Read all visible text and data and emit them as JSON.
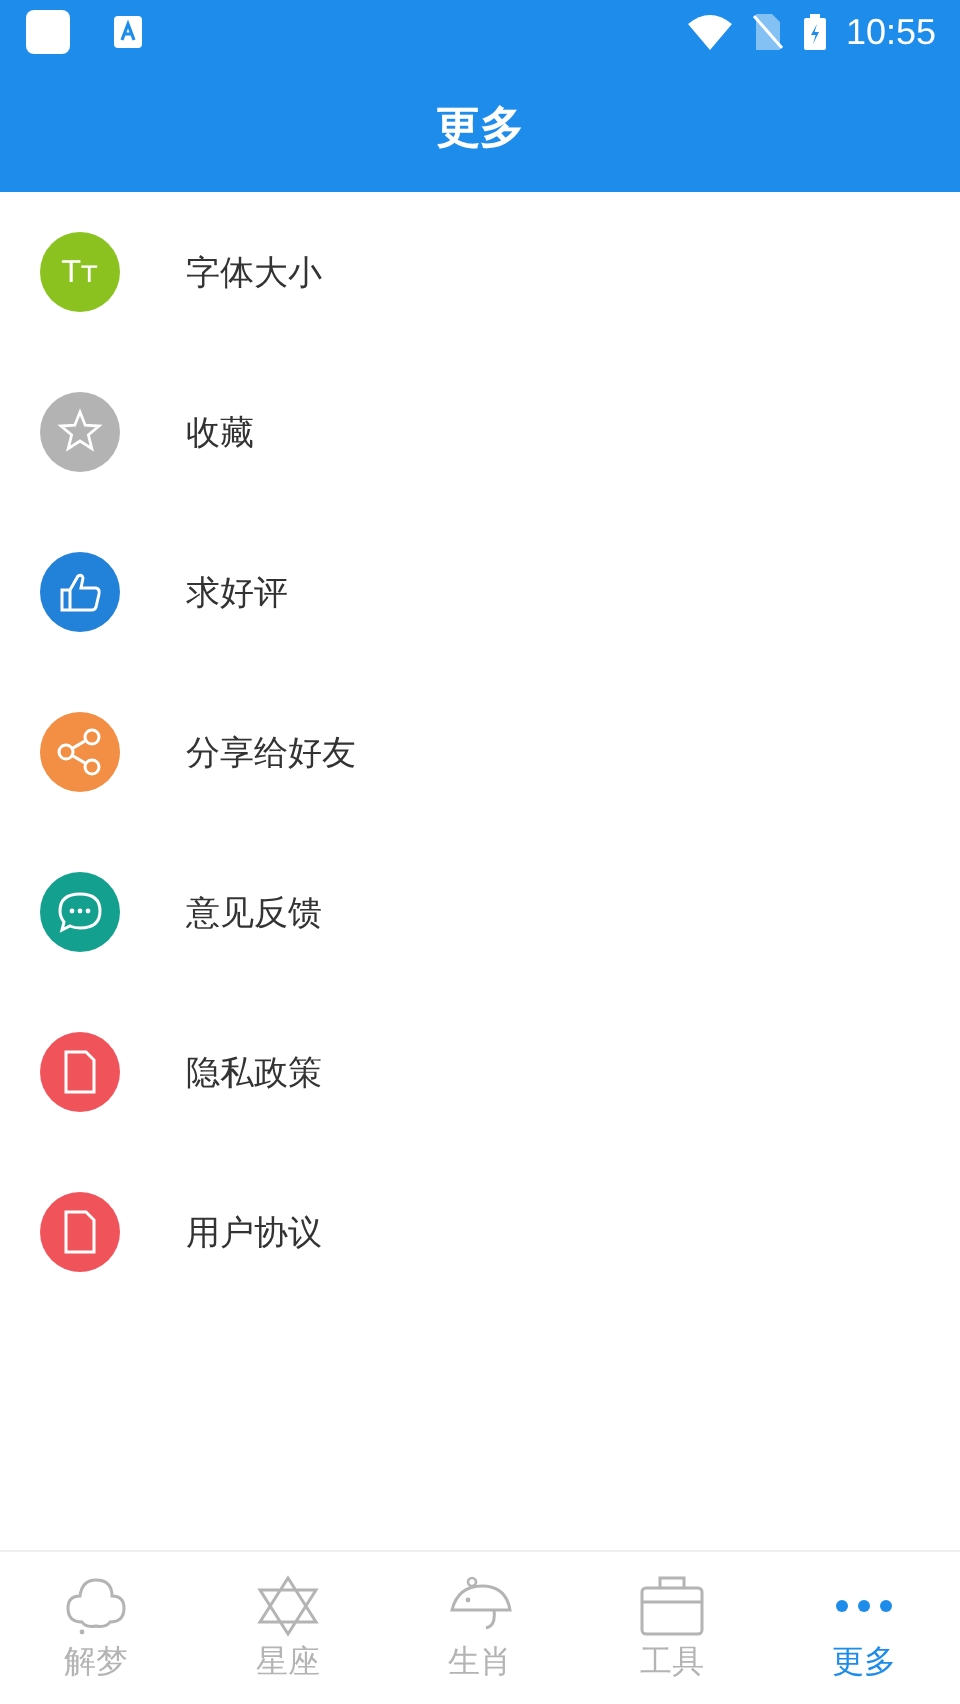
{
  "status_bar": {
    "time": "10:55"
  },
  "header": {
    "title": "更多"
  },
  "items": [
    {
      "label": "字体大小",
      "kind": "font",
      "icon_text": "Tт",
      "color": "#8cc21f"
    },
    {
      "label": "收藏",
      "kind": "star",
      "color": "#b3b3b3"
    },
    {
      "label": "求好评",
      "kind": "thumb",
      "color": "#2281d9"
    },
    {
      "label": "分享给好友",
      "kind": "share",
      "color": "#f28f44"
    },
    {
      "label": "意见反馈",
      "kind": "chat",
      "color": "#13a08e"
    },
    {
      "label": "隐私政策",
      "kind": "doc",
      "color": "#f0545a"
    },
    {
      "label": "用户协议",
      "kind": "doc",
      "color": "#f0545a"
    }
  ],
  "tabs": [
    {
      "label": "解梦",
      "kind": "cloud",
      "selected": false
    },
    {
      "label": "星座",
      "kind": "star6",
      "selected": false
    },
    {
      "label": "生肖",
      "kind": "mouse",
      "selected": false
    },
    {
      "label": "工具",
      "kind": "box",
      "selected": false
    },
    {
      "label": "更多",
      "kind": "dots",
      "selected": true
    }
  ]
}
